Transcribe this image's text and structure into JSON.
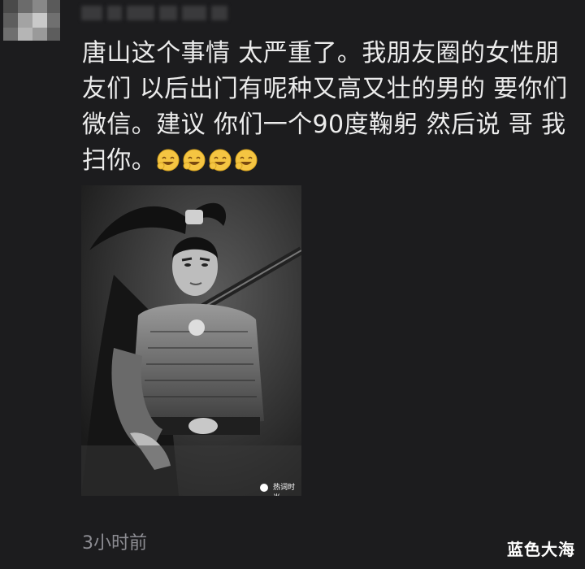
{
  "post": {
    "text": "唐山这个事情 太严重了。我朋友圈的女性朋友们 以后出门有呢种又高又壮的男的 要你们微信。建议 你们一个90度鞠躬 然后说 哥 我扫你。",
    "emoji": [
      "laughing-face-icon",
      "laughing-face-icon",
      "laughing-face-icon",
      "laughing-face-icon"
    ],
    "timestamp": "3小时前"
  },
  "photo": {
    "caption": "热词时尚"
  },
  "watermark": "蓝色大海",
  "colors": {
    "background": "#1c1c1e",
    "text": "#ececec",
    "timestamp": "#8d8d93",
    "emoji": "#f5c542"
  }
}
